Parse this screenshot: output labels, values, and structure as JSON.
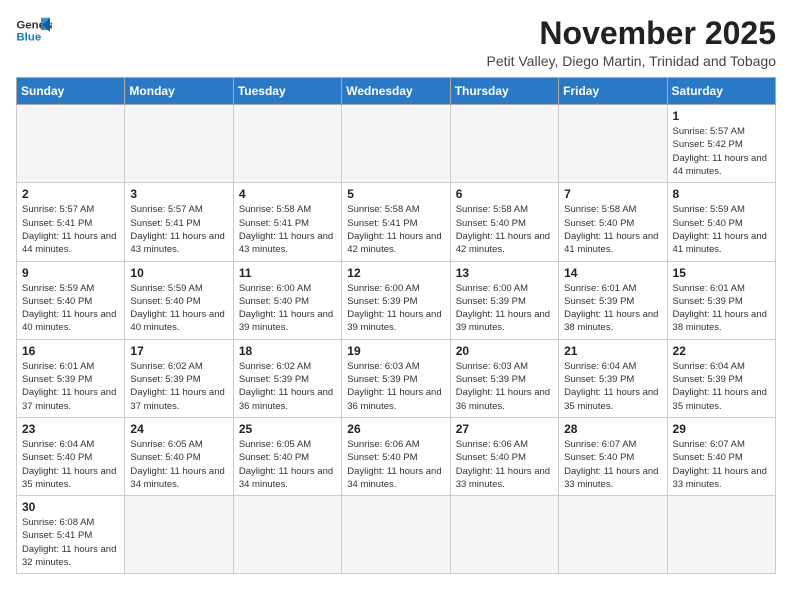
{
  "logo": {
    "line1": "General",
    "line2": "Blue"
  },
  "title": "November 2025",
  "location": "Petit Valley, Diego Martin, Trinidad and Tobago",
  "weekdays": [
    "Sunday",
    "Monday",
    "Tuesday",
    "Wednesday",
    "Thursday",
    "Friday",
    "Saturday"
  ],
  "days": {
    "1": {
      "sunrise": "5:57 AM",
      "sunset": "5:42 PM",
      "daylight": "11 hours and 44 minutes."
    },
    "2": {
      "sunrise": "5:57 AM",
      "sunset": "5:41 PM",
      "daylight": "11 hours and 44 minutes."
    },
    "3": {
      "sunrise": "5:57 AM",
      "sunset": "5:41 PM",
      "daylight": "11 hours and 43 minutes."
    },
    "4": {
      "sunrise": "5:58 AM",
      "sunset": "5:41 PM",
      "daylight": "11 hours and 43 minutes."
    },
    "5": {
      "sunrise": "5:58 AM",
      "sunset": "5:41 PM",
      "daylight": "11 hours and 42 minutes."
    },
    "6": {
      "sunrise": "5:58 AM",
      "sunset": "5:40 PM",
      "daylight": "11 hours and 42 minutes."
    },
    "7": {
      "sunrise": "5:58 AM",
      "sunset": "5:40 PM",
      "daylight": "11 hours and 41 minutes."
    },
    "8": {
      "sunrise": "5:59 AM",
      "sunset": "5:40 PM",
      "daylight": "11 hours and 41 minutes."
    },
    "9": {
      "sunrise": "5:59 AM",
      "sunset": "5:40 PM",
      "daylight": "11 hours and 40 minutes."
    },
    "10": {
      "sunrise": "5:59 AM",
      "sunset": "5:40 PM",
      "daylight": "11 hours and 40 minutes."
    },
    "11": {
      "sunrise": "6:00 AM",
      "sunset": "5:40 PM",
      "daylight": "11 hours and 39 minutes."
    },
    "12": {
      "sunrise": "6:00 AM",
      "sunset": "5:39 PM",
      "daylight": "11 hours and 39 minutes."
    },
    "13": {
      "sunrise": "6:00 AM",
      "sunset": "5:39 PM",
      "daylight": "11 hours and 39 minutes."
    },
    "14": {
      "sunrise": "6:01 AM",
      "sunset": "5:39 PM",
      "daylight": "11 hours and 38 minutes."
    },
    "15": {
      "sunrise": "6:01 AM",
      "sunset": "5:39 PM",
      "daylight": "11 hours and 38 minutes."
    },
    "16": {
      "sunrise": "6:01 AM",
      "sunset": "5:39 PM",
      "daylight": "11 hours and 37 minutes."
    },
    "17": {
      "sunrise": "6:02 AM",
      "sunset": "5:39 PM",
      "daylight": "11 hours and 37 minutes."
    },
    "18": {
      "sunrise": "6:02 AM",
      "sunset": "5:39 PM",
      "daylight": "11 hours and 36 minutes."
    },
    "19": {
      "sunrise": "6:03 AM",
      "sunset": "5:39 PM",
      "daylight": "11 hours and 36 minutes."
    },
    "20": {
      "sunrise": "6:03 AM",
      "sunset": "5:39 PM",
      "daylight": "11 hours and 36 minutes."
    },
    "21": {
      "sunrise": "6:04 AM",
      "sunset": "5:39 PM",
      "daylight": "11 hours and 35 minutes."
    },
    "22": {
      "sunrise": "6:04 AM",
      "sunset": "5:39 PM",
      "daylight": "11 hours and 35 minutes."
    },
    "23": {
      "sunrise": "6:04 AM",
      "sunset": "5:40 PM",
      "daylight": "11 hours and 35 minutes."
    },
    "24": {
      "sunrise": "6:05 AM",
      "sunset": "5:40 PM",
      "daylight": "11 hours and 34 minutes."
    },
    "25": {
      "sunrise": "6:05 AM",
      "sunset": "5:40 PM",
      "daylight": "11 hours and 34 minutes."
    },
    "26": {
      "sunrise": "6:06 AM",
      "sunset": "5:40 PM",
      "daylight": "11 hours and 34 minutes."
    },
    "27": {
      "sunrise": "6:06 AM",
      "sunset": "5:40 PM",
      "daylight": "11 hours and 33 minutes."
    },
    "28": {
      "sunrise": "6:07 AM",
      "sunset": "5:40 PM",
      "daylight": "11 hours and 33 minutes."
    },
    "29": {
      "sunrise": "6:07 AM",
      "sunset": "5:40 PM",
      "daylight": "11 hours and 33 minutes."
    },
    "30": {
      "sunrise": "6:08 AM",
      "sunset": "5:41 PM",
      "daylight": "11 hours and 32 minutes."
    }
  }
}
